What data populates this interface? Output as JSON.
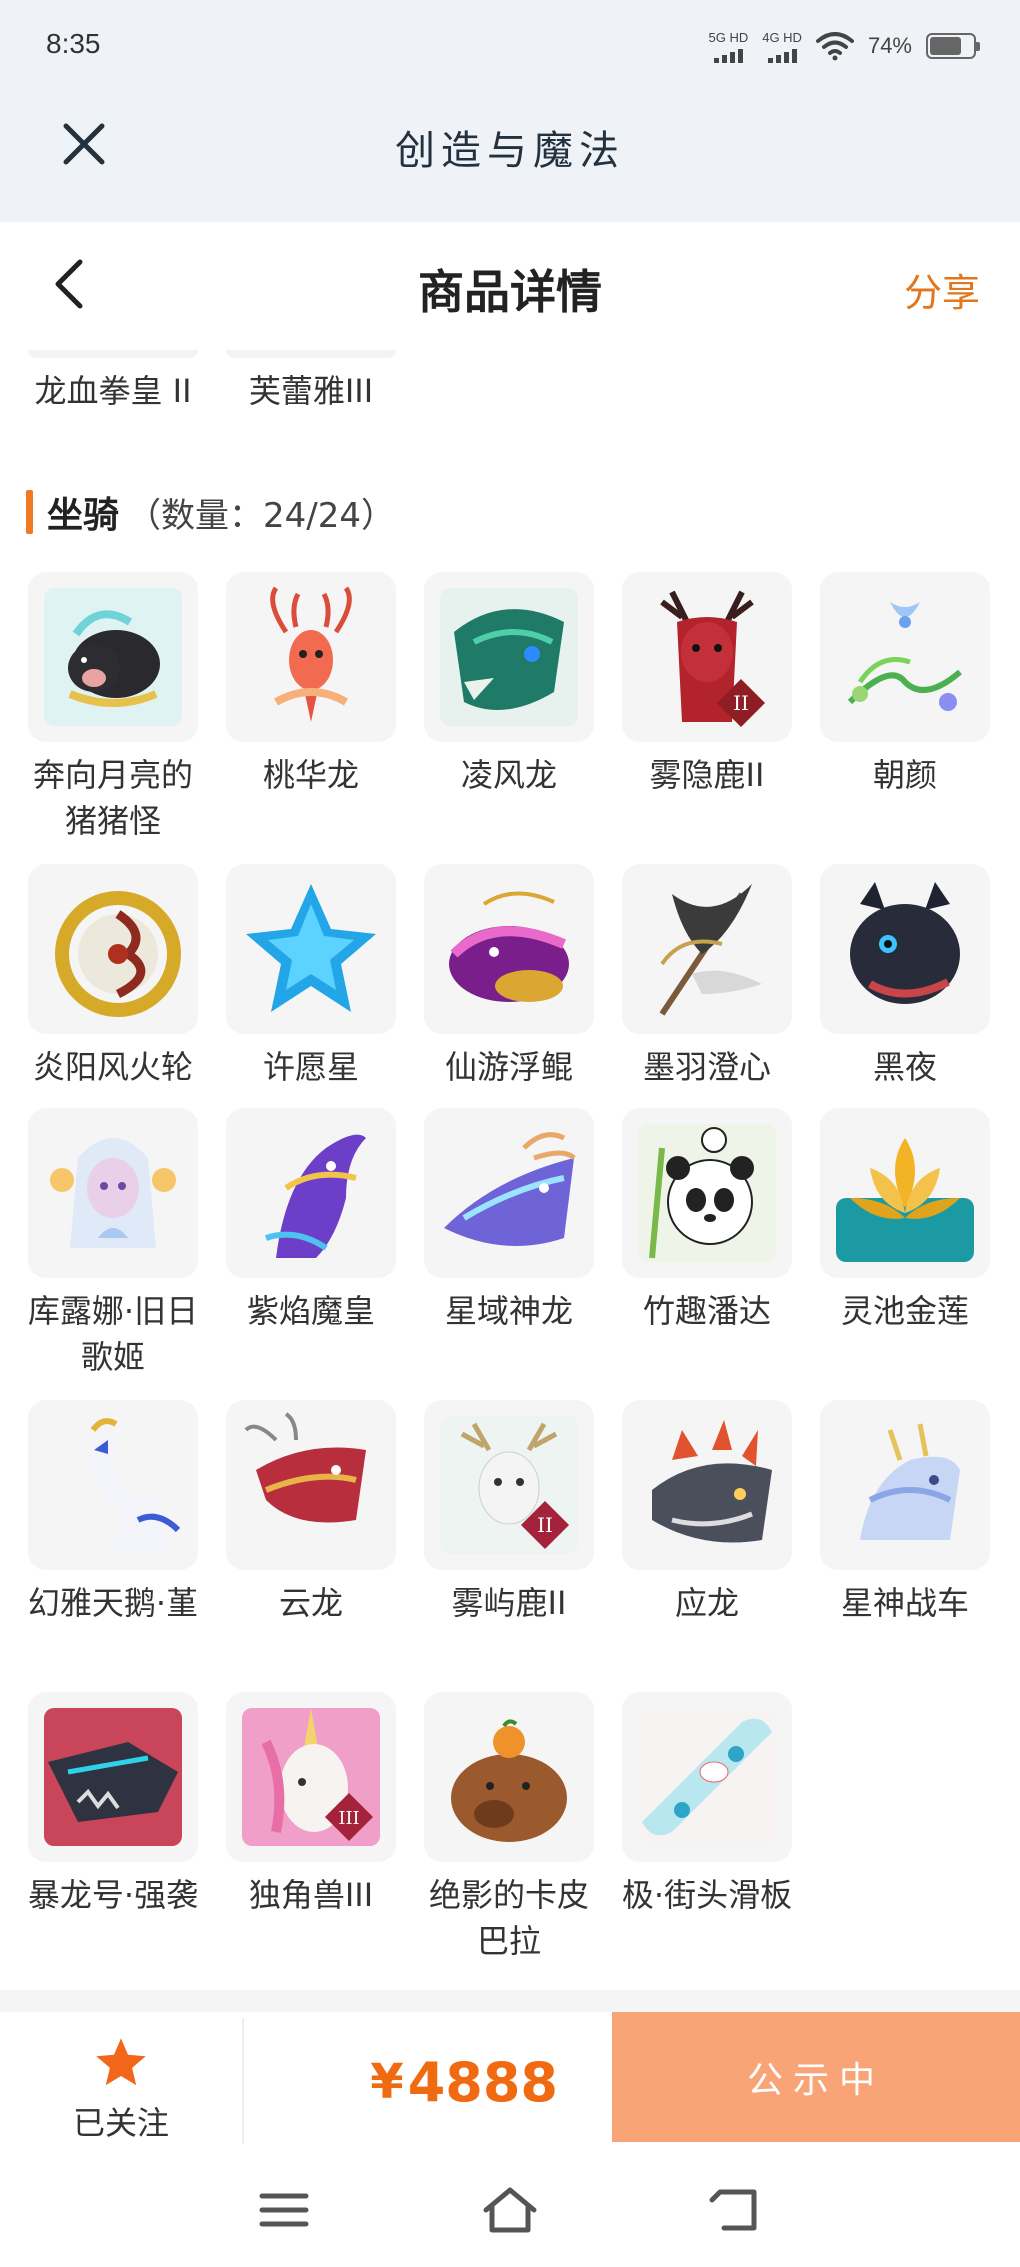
{
  "status_bar": {
    "time": "8:35",
    "net1": "5G HD",
    "net2": "4G HD",
    "battery_text": "74%",
    "battery_level": 0.74
  },
  "app_bar": {
    "title": "创造与魔法"
  },
  "header": {
    "title": "商品详情",
    "share_label": "分享"
  },
  "previous_row": [
    {
      "name": "龙血拳皇 II"
    },
    {
      "name": "芙蕾雅III"
    }
  ],
  "mounts_section": {
    "title": "坐骑",
    "count_text": "（数量：24/24）",
    "accent_color": "#f07a24",
    "items": [
      {
        "name": "奔向月亮的猪猪怪",
        "icon": "pig-icon"
      },
      {
        "name": "桃华龙",
        "icon": "peach-dragon-icon"
      },
      {
        "name": "凌风龙",
        "icon": "wind-dragon-icon"
      },
      {
        "name": "雾隐鹿II",
        "icon": "mist-deer-icon"
      },
      {
        "name": "朝颜",
        "icon": "morning-glory-icon"
      },
      {
        "name": "炎阳风火轮",
        "icon": "fire-wheel-icon"
      },
      {
        "name": "许愿星",
        "icon": "wish-star-icon"
      },
      {
        "name": "仙游浮鲲",
        "icon": "floating-kun-icon"
      },
      {
        "name": "墨羽澄心",
        "icon": "ink-feather-icon"
      },
      {
        "name": "黑夜",
        "icon": "night-dragon-icon"
      },
      {
        "name": "库露娜·旧日歌姬",
        "icon": "songstress-icon"
      },
      {
        "name": "紫焰魔皇",
        "icon": "purple-phoenix-icon"
      },
      {
        "name": "星域神龙",
        "icon": "star-dragon-icon"
      },
      {
        "name": "竹趣潘达",
        "icon": "panda-icon"
      },
      {
        "name": "灵池金莲",
        "icon": "golden-lotus-icon"
      },
      {
        "name": "幻雅天鹅·堇",
        "icon": "swan-icon"
      },
      {
        "name": "云龙",
        "icon": "cloud-dragon-icon"
      },
      {
        "name": "雾屿鹿II",
        "icon": "island-deer-icon"
      },
      {
        "name": "应龙",
        "icon": "ying-dragon-icon"
      },
      {
        "name": "星神战车",
        "icon": "star-chariot-icon"
      },
      {
        "name": "暴龙号·强袭",
        "icon": "mecha-rex-icon"
      },
      {
        "name": "独角兽III",
        "icon": "unicorn-icon"
      },
      {
        "name": "绝影的卡皮巴拉",
        "icon": "capybara-icon"
      },
      {
        "name": "极·街头滑板",
        "icon": "skateboard-icon"
      }
    ]
  },
  "action_bar": {
    "follow_label": "已关注",
    "price_symbol": "¥",
    "price_value": "4888",
    "status_label": "公示中",
    "price_color": "#f06a12",
    "status_bg": "#f8a476"
  }
}
